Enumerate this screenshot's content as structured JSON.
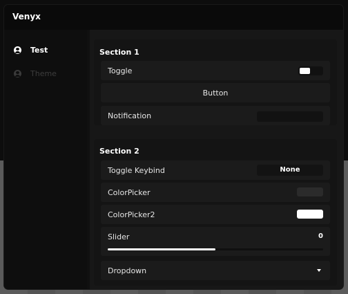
{
  "window": {
    "title": "Venyx"
  },
  "sidebar": {
    "items": [
      {
        "label": "Test",
        "icon": "user-circle-icon",
        "active": true
      },
      {
        "label": "Theme",
        "icon": "user-circle-icon",
        "active": false
      }
    ]
  },
  "sections": [
    {
      "title": "Section 1",
      "toggle": {
        "label": "Toggle",
        "state": true
      },
      "button": {
        "label": "Button"
      },
      "notification": {
        "label": "Notification",
        "value": ""
      }
    },
    {
      "title": "Section 2",
      "keybind": {
        "label": "Toggle Keybind",
        "value": "None"
      },
      "colorpicker1": {
        "label": "ColorPicker",
        "color": "#2b2b2b"
      },
      "colorpicker2": {
        "label": "ColorPicker2",
        "color": "#ffffff"
      },
      "slider": {
        "label": "Slider",
        "value": "0",
        "fill_fraction": 0.5
      },
      "dropdown": {
        "label": "Dropdown"
      }
    }
  ],
  "colors": {
    "accent": "#ffffff",
    "background": "#101010",
    "row": "#1b1b1b",
    "inactive_text": "#3d3d3d"
  }
}
